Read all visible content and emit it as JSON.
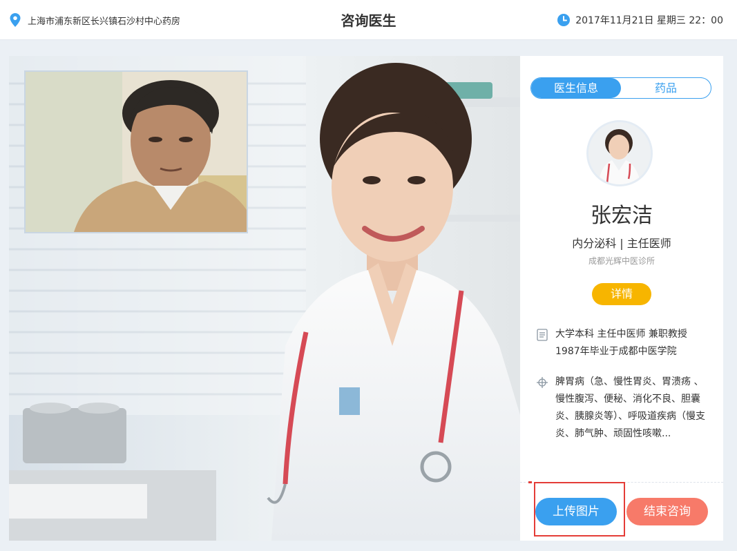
{
  "header": {
    "location": "上海市浦东新区长兴镇石沙村中心药房",
    "title": "咨询医生",
    "datetime": "2017年11月21日  星期三  22：00"
  },
  "icons": {
    "location": "location-pin-icon",
    "clock": "clock-icon",
    "education": "document-icon",
    "specialty": "crosshair-icon"
  },
  "colors": {
    "primary": "#3aa0ef",
    "detail": "#f7b500",
    "end": "#f77a69",
    "highlight": "#e43c37"
  },
  "tabs": [
    {
      "label": "医生信息",
      "active": true
    },
    {
      "label": "药品",
      "active": false
    }
  ],
  "doctor": {
    "name": "张宏洁",
    "department": "内分泌科 | 主任医师",
    "clinic": "成都光辉中医诊所",
    "detail_label": "详情",
    "education": "大学本科 主任中医师  兼职教授 1987年毕业于成都中医学院",
    "specialty": "脾胃病（急、慢性胃炎、胃溃疡  、慢性腹泻、便秘、消化不良、胆囊炎、胰腺炎等）、呼吸道疾病（慢支炎、肺气肿、顽固性咳嗽..."
  },
  "actions": {
    "upload_label": "上传图片",
    "end_label": "结束咨询"
  }
}
